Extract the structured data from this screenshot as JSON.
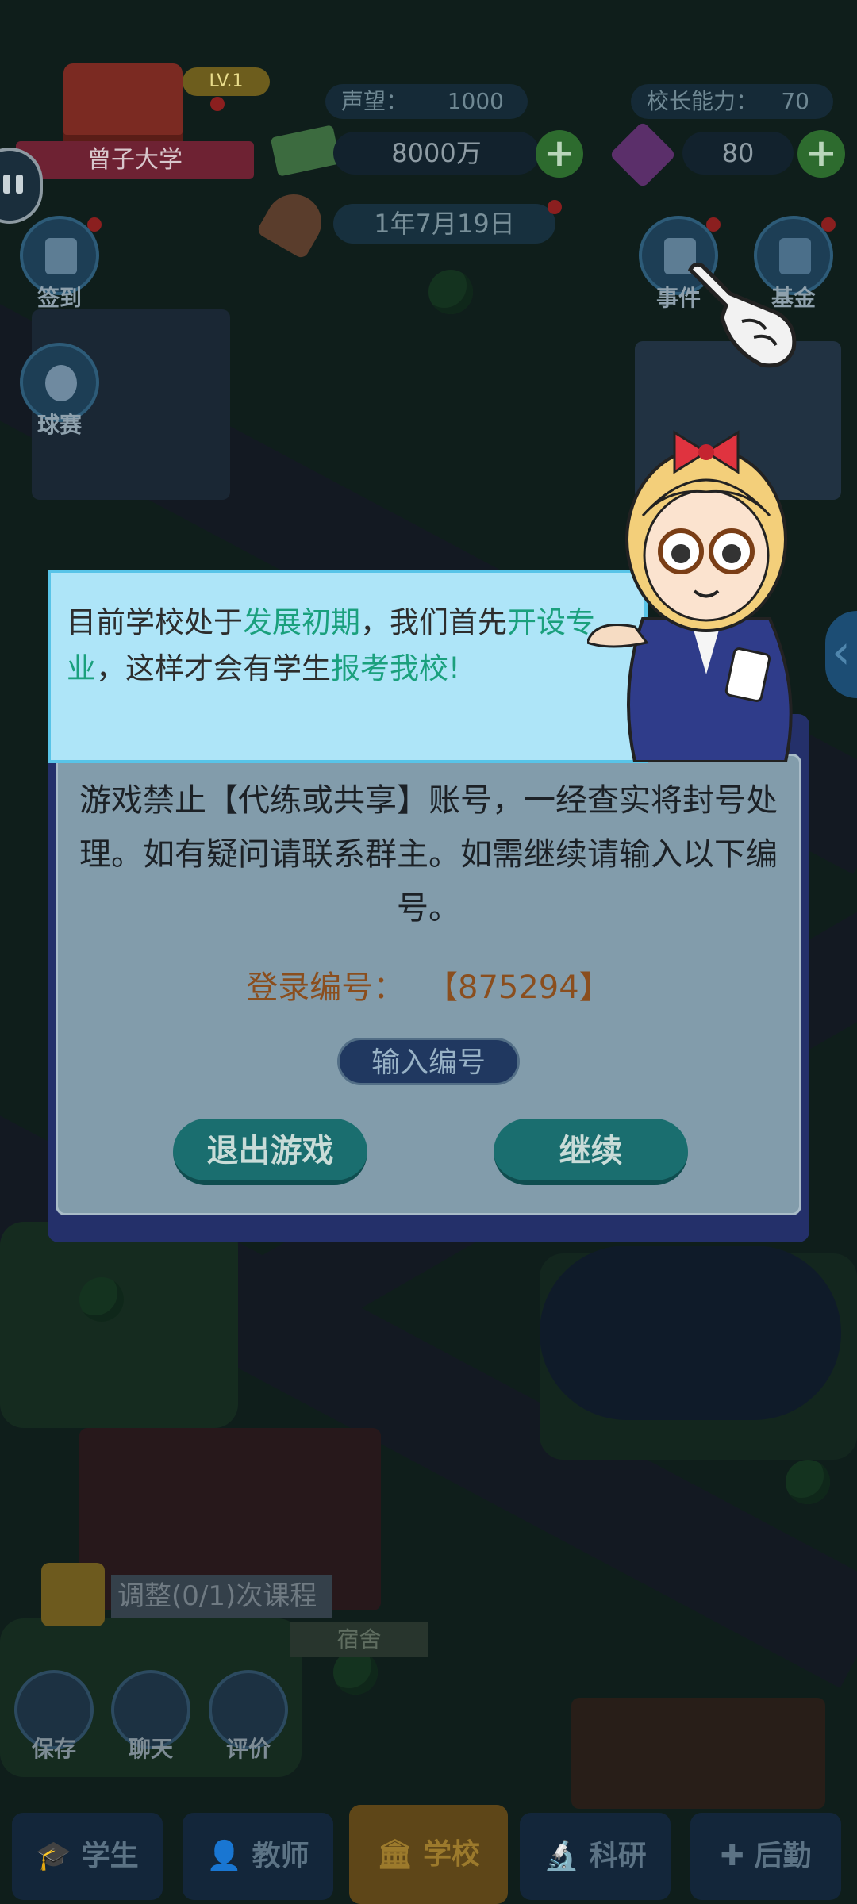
{
  "hud": {
    "school_level": "LV.1",
    "school_name": "曾子大学",
    "reputation_label": "声望：",
    "reputation_value": "1000",
    "principal_label": "校长能力：",
    "principal_value": "70",
    "money": "8000万",
    "gems": "80",
    "plus": "+",
    "date": "1年7月19日"
  },
  "left_buttons": [
    {
      "label": "签到",
      "icon": "checklist-icon"
    },
    {
      "label": "球赛",
      "icon": "soccer-ball-icon"
    }
  ],
  "right_buttons": [
    {
      "label": "事件",
      "icon": "document-icon"
    },
    {
      "label": "基金",
      "icon": "chart-icon"
    }
  ],
  "tip": {
    "part1": "目前学校处于",
    "hl1": "发展初期",
    "part2": "，我们首先",
    "hl2": "开设专业",
    "part3": "，这样才会有学生",
    "hl3": "报考我校!"
  },
  "dialog": {
    "message": "游戏禁止【代练或共享】账号，一经查实将封号处理。如有疑问请联系群主。如需继续请输入以下编号。",
    "code_label": "登录编号：",
    "code_value": "【875294】",
    "input_button": "输入编号",
    "exit_button": "退出游戏",
    "continue_button": "继续"
  },
  "task": {
    "label": "调整(0/1)次课程",
    "dorm": "宿舍"
  },
  "bottom_buttons": [
    {
      "label": "保存",
      "icon": "download-icon"
    },
    {
      "label": "聊天",
      "icon": "chat-icon"
    },
    {
      "label": "评价",
      "icon": "edit-icon"
    }
  ],
  "nav": [
    {
      "label": "学生",
      "icon": "graduation-cap-icon"
    },
    {
      "label": "教师",
      "icon": "person-icon"
    },
    {
      "label": "学校",
      "icon": "building-icon"
    },
    {
      "label": "科研",
      "icon": "microscope-icon"
    },
    {
      "label": "后勤",
      "icon": "medical-kit-icon"
    }
  ],
  "colors": {
    "tip_bg": "#aee5f8",
    "tip_highlight": "#1aa07d",
    "dialog_frame": "#24306a",
    "button_teal": "#1a6e6f",
    "code_text": "#8a4e1e"
  }
}
